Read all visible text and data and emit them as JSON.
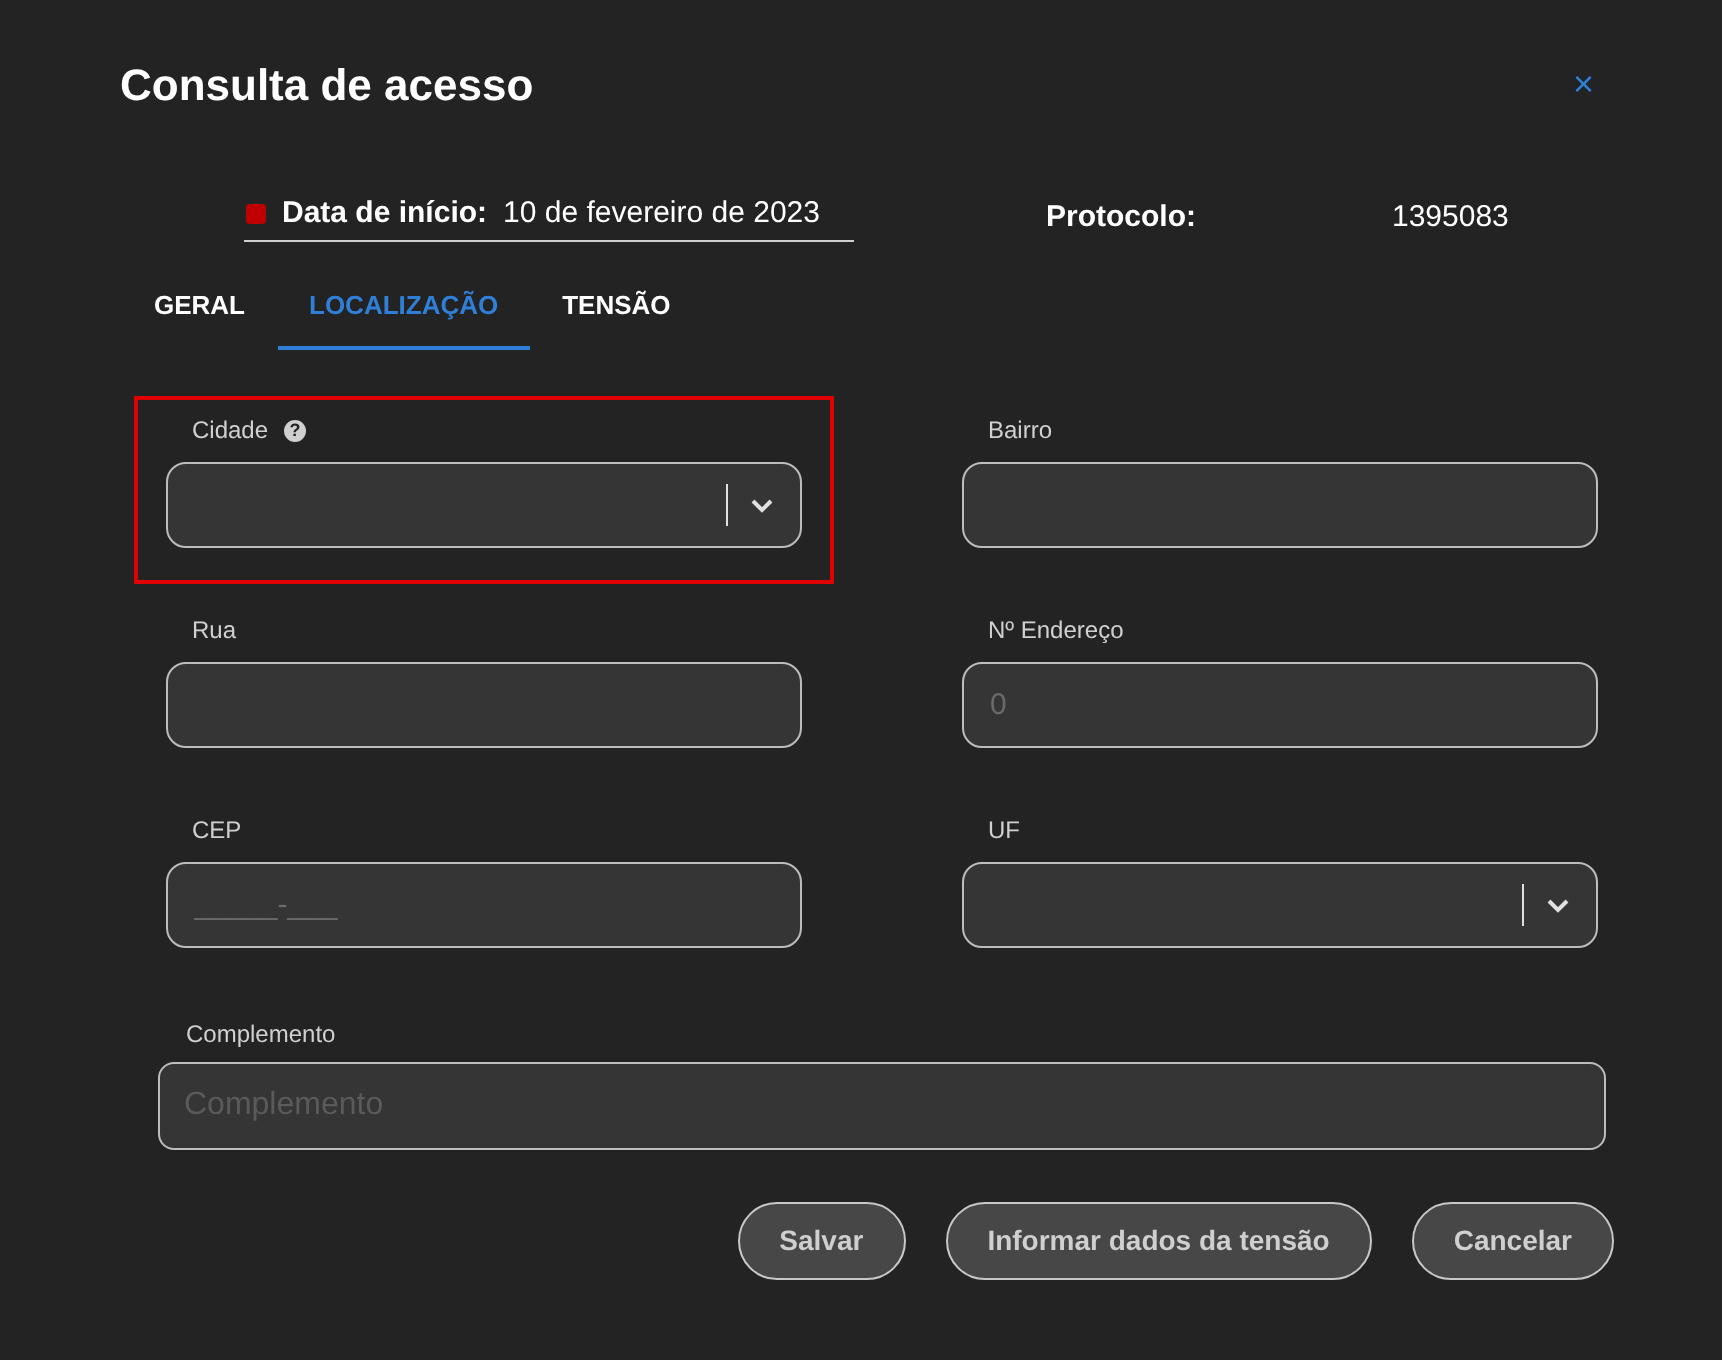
{
  "dialog": {
    "title": "Consulta de acesso",
    "close": "×"
  },
  "header": {
    "date_label": "Data de início:",
    "date_value": "10 de fevereiro de 2023",
    "status": {
      "color": "#c00000"
    },
    "protocol_label": "Protocolo:",
    "protocol_value": "1395083"
  },
  "tabs": [
    {
      "label": "GERAL",
      "selected": false
    },
    {
      "label": "LOCALIZAÇÃO",
      "selected": true
    },
    {
      "label": "TENSÃO",
      "selected": false
    }
  ],
  "fields": [
    {
      "label": "Cidade",
      "kind": "select",
      "help": "?",
      "highlighted": true
    },
    {
      "label": "Bairro",
      "kind": "text",
      "highlighted": false
    },
    {
      "label": "Rua",
      "kind": "text",
      "highlighted": false
    },
    {
      "label": "Nº Endereço",
      "kind": "text",
      "placeholder": "0",
      "highlighted": false
    },
    {
      "label": "CEP",
      "kind": "text",
      "placeholder": "_____-___",
      "highlighted": false
    },
    {
      "label": "UF",
      "kind": "select",
      "highlighted": false
    }
  ],
  "complement": {
    "label": "Complemento",
    "placeholder": "Complemento"
  },
  "buttons": [
    "Salvar",
    "Informar dados da tensão",
    "Cancelar"
  ]
}
